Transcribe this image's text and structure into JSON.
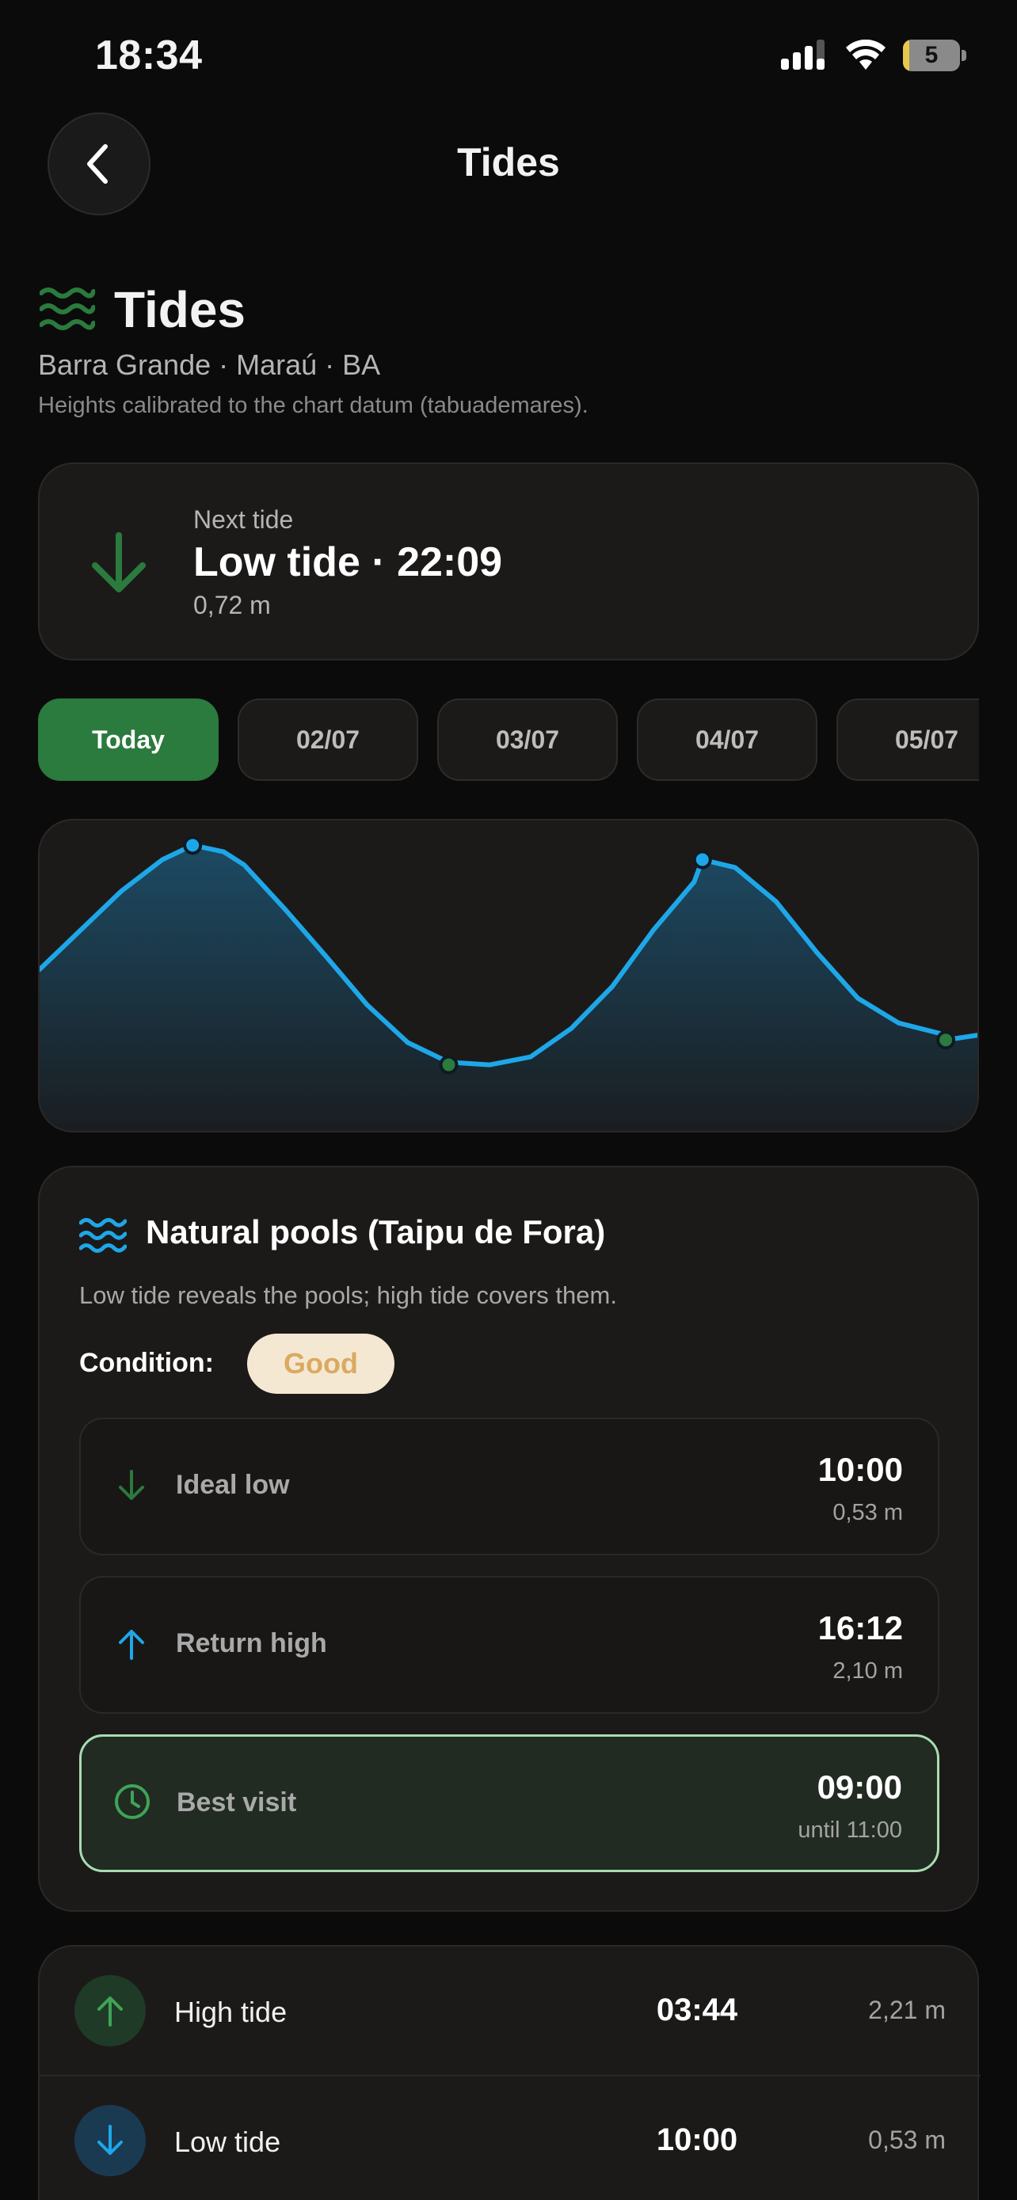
{
  "status_bar": {
    "time": "18:34",
    "battery": "5"
  },
  "header": {
    "title": "Tides"
  },
  "intro": {
    "title": "Tides",
    "location": "Barra Grande · Maraú · BA",
    "datum_note": "Heights calibrated to the chart datum (tabuademares)."
  },
  "next_tide": {
    "label": "Next tide",
    "title": "Low tide · 22:09",
    "height": "0,72 m"
  },
  "day_tabs": [
    "Today",
    "02/07",
    "03/07",
    "04/07",
    "05/07"
  ],
  "chart_data": {
    "type": "area",
    "x": [
      0,
      1,
      2,
      3,
      3.74,
      4.5,
      5,
      6,
      7,
      8,
      9,
      10,
      11,
      12,
      13,
      14,
      15,
      16,
      16.2,
      17,
      18,
      19,
      20,
      21,
      22,
      22.15,
      23
    ],
    "y": [
      1.26,
      1.56,
      1.86,
      2.1,
      2.21,
      2.16,
      2.06,
      1.72,
      1.36,
      0.99,
      0.7,
      0.55,
      0.53,
      0.59,
      0.81,
      1.13,
      1.56,
      1.93,
      2.1,
      2.04,
      1.78,
      1.39,
      1.04,
      0.85,
      0.77,
      0.72,
      0.76
    ],
    "extrema": [
      {
        "x": 3.74,
        "y": 2.21,
        "kind": "high"
      },
      {
        "x": 10.0,
        "y": 0.53,
        "kind": "low"
      },
      {
        "x": 16.2,
        "y": 2.1,
        "kind": "high"
      },
      {
        "x": 22.15,
        "y": 0.72,
        "kind": "low"
      }
    ],
    "xlim": [
      0,
      23
    ],
    "ylim": [
      0,
      2.4
    ],
    "grid": false,
    "line_color": "#1ea7e8",
    "high_marker_color": "#1ea7e8",
    "low_marker_color": "#2b7a3e"
  },
  "pools": {
    "title": "Natural pools (Taipu de Fora)",
    "description": "Low tide reveals the pools; high tide covers them.",
    "condition_label": "Condition:",
    "condition_value": "Good",
    "rows": [
      {
        "label": "Ideal low",
        "time": "10:00",
        "sub": "0,53 m"
      },
      {
        "label": "Return high",
        "time": "16:12",
        "sub": "2,10 m"
      },
      {
        "label": "Best visit",
        "time": "09:00",
        "sub": "until 11:00"
      }
    ]
  },
  "tide_list": [
    {
      "type": "High tide",
      "time": "03:44",
      "height": "2,21 m"
    },
    {
      "type": "Low tide",
      "time": "10:00",
      "height": "0,53 m"
    }
  ],
  "colors": {
    "accent_green": "#2b7a3e",
    "accent_blue": "#1ea7e8",
    "badge_bg": "#f5e8d3",
    "badge_text": "#d9aa60",
    "card_bg": "#1c1a19"
  }
}
